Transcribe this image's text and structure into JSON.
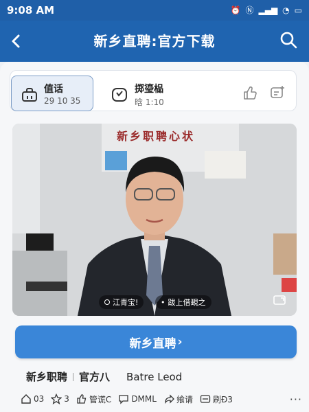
{
  "status_bar": {
    "time": "9:08 AM"
  },
  "nav": {
    "title": "新乡直聘:官方下载"
  },
  "info_bar": {
    "card_a": {
      "title": "值话",
      "subtitle": "29 10 35"
    },
    "card_b": {
      "title": "掷瑬榀",
      "subtitle": "晗 1:10"
    }
  },
  "video": {
    "wall_text": "新乡职聘心状",
    "chip_1": "江青宝!",
    "chip_2": "跋上借覡之"
  },
  "primary_button": {
    "label": "新乡直聘",
    "chevron": "›"
  },
  "caption": {
    "part1": "新乡职聘",
    "part2": "官方八",
    "part3": "Batre Leod"
  },
  "actions": [
    {
      "label": "03",
      "icon": "home-icon"
    },
    {
      "label": "3",
      "icon": "star-icon"
    },
    {
      "label": "管谎C",
      "icon": "thumb-icon"
    },
    {
      "label": "DMML",
      "icon": "comment-icon"
    },
    {
      "label": "飨请",
      "icon": "share-icon"
    },
    {
      "label": "刷Đ3",
      "icon": "caption-icon"
    }
  ],
  "more": "···",
  "colors": {
    "brand_blue": "#1f64b0",
    "button_blue": "#3a86d8",
    "sheet": "#f6f7f9"
  }
}
